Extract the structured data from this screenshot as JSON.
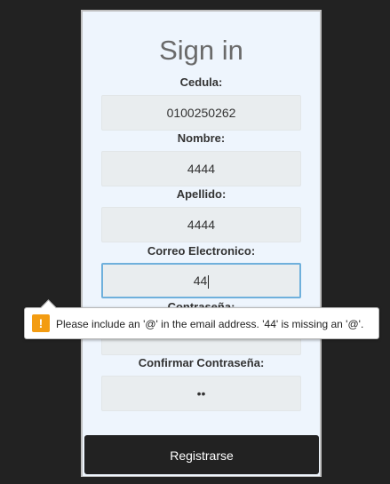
{
  "form": {
    "title": "Sign in",
    "fields": [
      {
        "label": "Cedula:",
        "value": "0100250262"
      },
      {
        "label": "Nombre:",
        "value": "4444"
      },
      {
        "label": "Apellido:",
        "value": "4444"
      },
      {
        "label": "Correo Electronico:",
        "value": "44"
      },
      {
        "label": "Contraseña:",
        "value": ""
      },
      {
        "label": "Confirmar Contraseña:",
        "value": "••"
      }
    ],
    "submit_label": "Registrarse"
  },
  "validation": {
    "icon": "warning-icon",
    "icon_glyph": "!",
    "message": "Please include an '@' in the email address. '44' is missing an '@'."
  },
  "colors": {
    "background": "#222222",
    "card": "#eef5fd",
    "field": "#e9edef",
    "focus_border": "#6fb0dc",
    "button": "#222222",
    "warning": "#f39c12"
  }
}
